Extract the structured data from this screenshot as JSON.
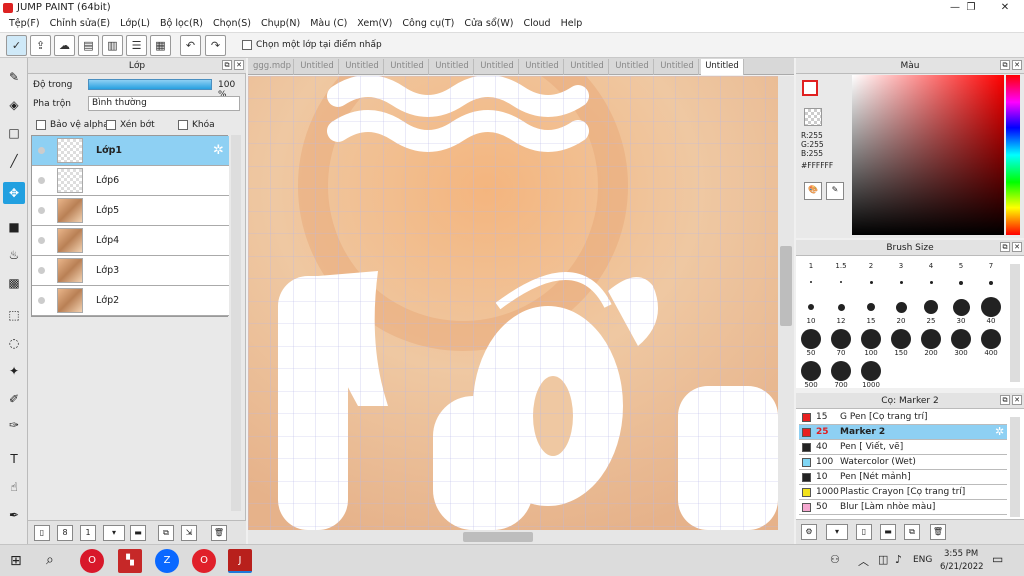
{
  "window": {
    "title": "JUMP PAINT (64bit)",
    "minimize": "—",
    "maximize": "❐",
    "close": "✕"
  },
  "menu": [
    "Tệp(F)",
    "Chỉnh sửa(E)",
    "Lớp(L)",
    "Bộ lọc(R)",
    "Chọn(S)",
    "Chụp(N)",
    "Màu (C)",
    "Xem(V)",
    "Công cụ(T)",
    "Cửa sổ(W)",
    "Cloud",
    "Help"
  ],
  "toolbar": {
    "pick_layer_label": "Chọn một lớp tại điểm nhấp",
    "undo_icon": "↶",
    "redo_icon": "↷"
  },
  "layer_panel": {
    "title": "Lớp",
    "opacity_label": "Độ trong",
    "opacity_value": "100 %",
    "opacity": 1.0,
    "blend_label": "Pha trộn",
    "blend_mode": "Bình thường",
    "protect_alpha": "Bảo vệ alpha",
    "clipping": "Xén bớt",
    "lock": "Khóa",
    "layers": [
      {
        "name": "Lớp1",
        "selected": true,
        "thumb": "empty"
      },
      {
        "name": "Lớp6",
        "selected": false,
        "thumb": "empty"
      },
      {
        "name": "Lớp5",
        "selected": false,
        "thumb": "photo"
      },
      {
        "name": "Lớp4",
        "selected": false,
        "thumb": "photo"
      },
      {
        "name": "Lớp3",
        "selected": false,
        "thumb": "photo"
      },
      {
        "name": "Lớp2",
        "selected": false,
        "thumb": "photo"
      }
    ]
  },
  "tabs": [
    "ggg.mdp",
    "Untitled",
    "Untitled",
    "Untitled",
    "Untitled",
    "Untitled",
    "Untitled",
    "Untitled",
    "Untitled",
    "Untitled",
    "Untitled"
  ],
  "active_tab": 10,
  "color_panel": {
    "title": "Màu",
    "r": "R:255",
    "g": "G:255",
    "b": "B:255",
    "hex": "#FFFFFF",
    "accent": "#e02020"
  },
  "brush_panel": {
    "title": "Brush Size",
    "sizes": [
      "1",
      "1.5",
      "2",
      "3",
      "4",
      "5",
      "7",
      "10",
      "12",
      "15",
      "20",
      "25",
      "30",
      "40",
      "50",
      "70",
      "100",
      "150",
      "200",
      "300",
      "400",
      "500",
      "700",
      "1000"
    ]
  },
  "pen_panel": {
    "title": "Cọ: Marker 2",
    "pens": [
      {
        "size": "15",
        "name": "G Pen [Cọ trang trí]",
        "color": "#e82020"
      },
      {
        "size": "25",
        "name": "Marker 2",
        "color": "#e82020",
        "selected": true
      },
      {
        "size": "40",
        "name": "Pen [ Viết, vẽ]",
        "color": "#222222"
      },
      {
        "size": "100",
        "name": "Watercolor (Wet)",
        "color": "#7fd6f5"
      },
      {
        "size": "10",
        "name": "Pen [Nét mảnh]",
        "color": "#222222"
      },
      {
        "size": "1000",
        "name": "Plastic Crayon [Cọ trang trí]",
        "color": "#f2e21a"
      },
      {
        "size": "50",
        "name": "Blur [Làm nhòe màu]",
        "color": "#f5a8d0"
      }
    ]
  },
  "taskbar": {
    "lang": "ENG",
    "time": "3:55 PM",
    "date": "6/21/2022"
  }
}
